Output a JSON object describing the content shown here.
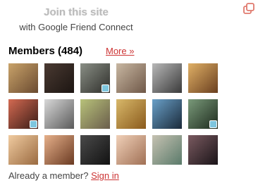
{
  "join": {
    "label": "Join this site",
    "subtitle": "with Google Friend Connect"
  },
  "members": {
    "title": "Members (484)",
    "more_label": "More »"
  },
  "footer": {
    "prompt": "Already a member?",
    "signin_label": "Sign in"
  },
  "colors": {
    "link": "#cc3333",
    "join_text": "#b9b9b9",
    "popout_icon": "#e07a6e"
  },
  "icons": {
    "popout": "popout-icon",
    "member_badge": "twitter-badge-icon"
  },
  "member_rows": [
    [
      {
        "alt": "member-1",
        "c1": "#c9a36a",
        "c2": "#6a4a30",
        "badge": false
      },
      {
        "alt": "member-2",
        "c1": "#4a3a32",
        "c2": "#1c1512",
        "badge": false
      },
      {
        "alt": "member-3",
        "c1": "#8a8f86",
        "c2": "#2e2e2a",
        "badge": true
      },
      {
        "alt": "member-4",
        "c1": "#c8b7a2",
        "c2": "#6f5848",
        "badge": false
      },
      {
        "alt": "member-5",
        "c1": "#b8b8b8",
        "c2": "#3a3a3a",
        "badge": false
      },
      {
        "alt": "member-6",
        "c1": "#e0b066",
        "c2": "#6a3f1f",
        "badge": false
      }
    ],
    [
      {
        "alt": "member-7",
        "c1": "#d46a52",
        "c2": "#3a1c16",
        "badge": true
      },
      {
        "alt": "member-8",
        "c1": "#d8d8d8",
        "c2": "#5a5a5a",
        "badge": false
      },
      {
        "alt": "member-9",
        "c1": "#b8c27a",
        "c2": "#6a5d4b",
        "badge": false
      },
      {
        "alt": "member-10",
        "c1": "#d8b86a",
        "c2": "#8a5a1c",
        "badge": false
      },
      {
        "alt": "member-11",
        "c1": "#6aa0c8",
        "c2": "#1a2a3a",
        "badge": false
      },
      {
        "alt": "member-12",
        "c1": "#7a9a7a",
        "c2": "#1d2a1d",
        "badge": true
      }
    ],
    [
      {
        "alt": "member-13",
        "c1": "#f0cba0",
        "c2": "#9a6a40",
        "badge": false
      },
      {
        "alt": "member-14",
        "c1": "#e6b08a",
        "c2": "#6a3a22",
        "badge": false
      },
      {
        "alt": "member-15",
        "c1": "#4a4a4a",
        "c2": "#121212",
        "badge": false
      },
      {
        "alt": "member-16",
        "c1": "#f0d0b8",
        "c2": "#a07055",
        "badge": false
      },
      {
        "alt": "member-17",
        "c1": "#c6c2b2",
        "c2": "#5a7a6a",
        "badge": false
      },
      {
        "alt": "member-18",
        "c1": "#7a5a60",
        "c2": "#1a1418",
        "badge": false
      }
    ]
  ]
}
